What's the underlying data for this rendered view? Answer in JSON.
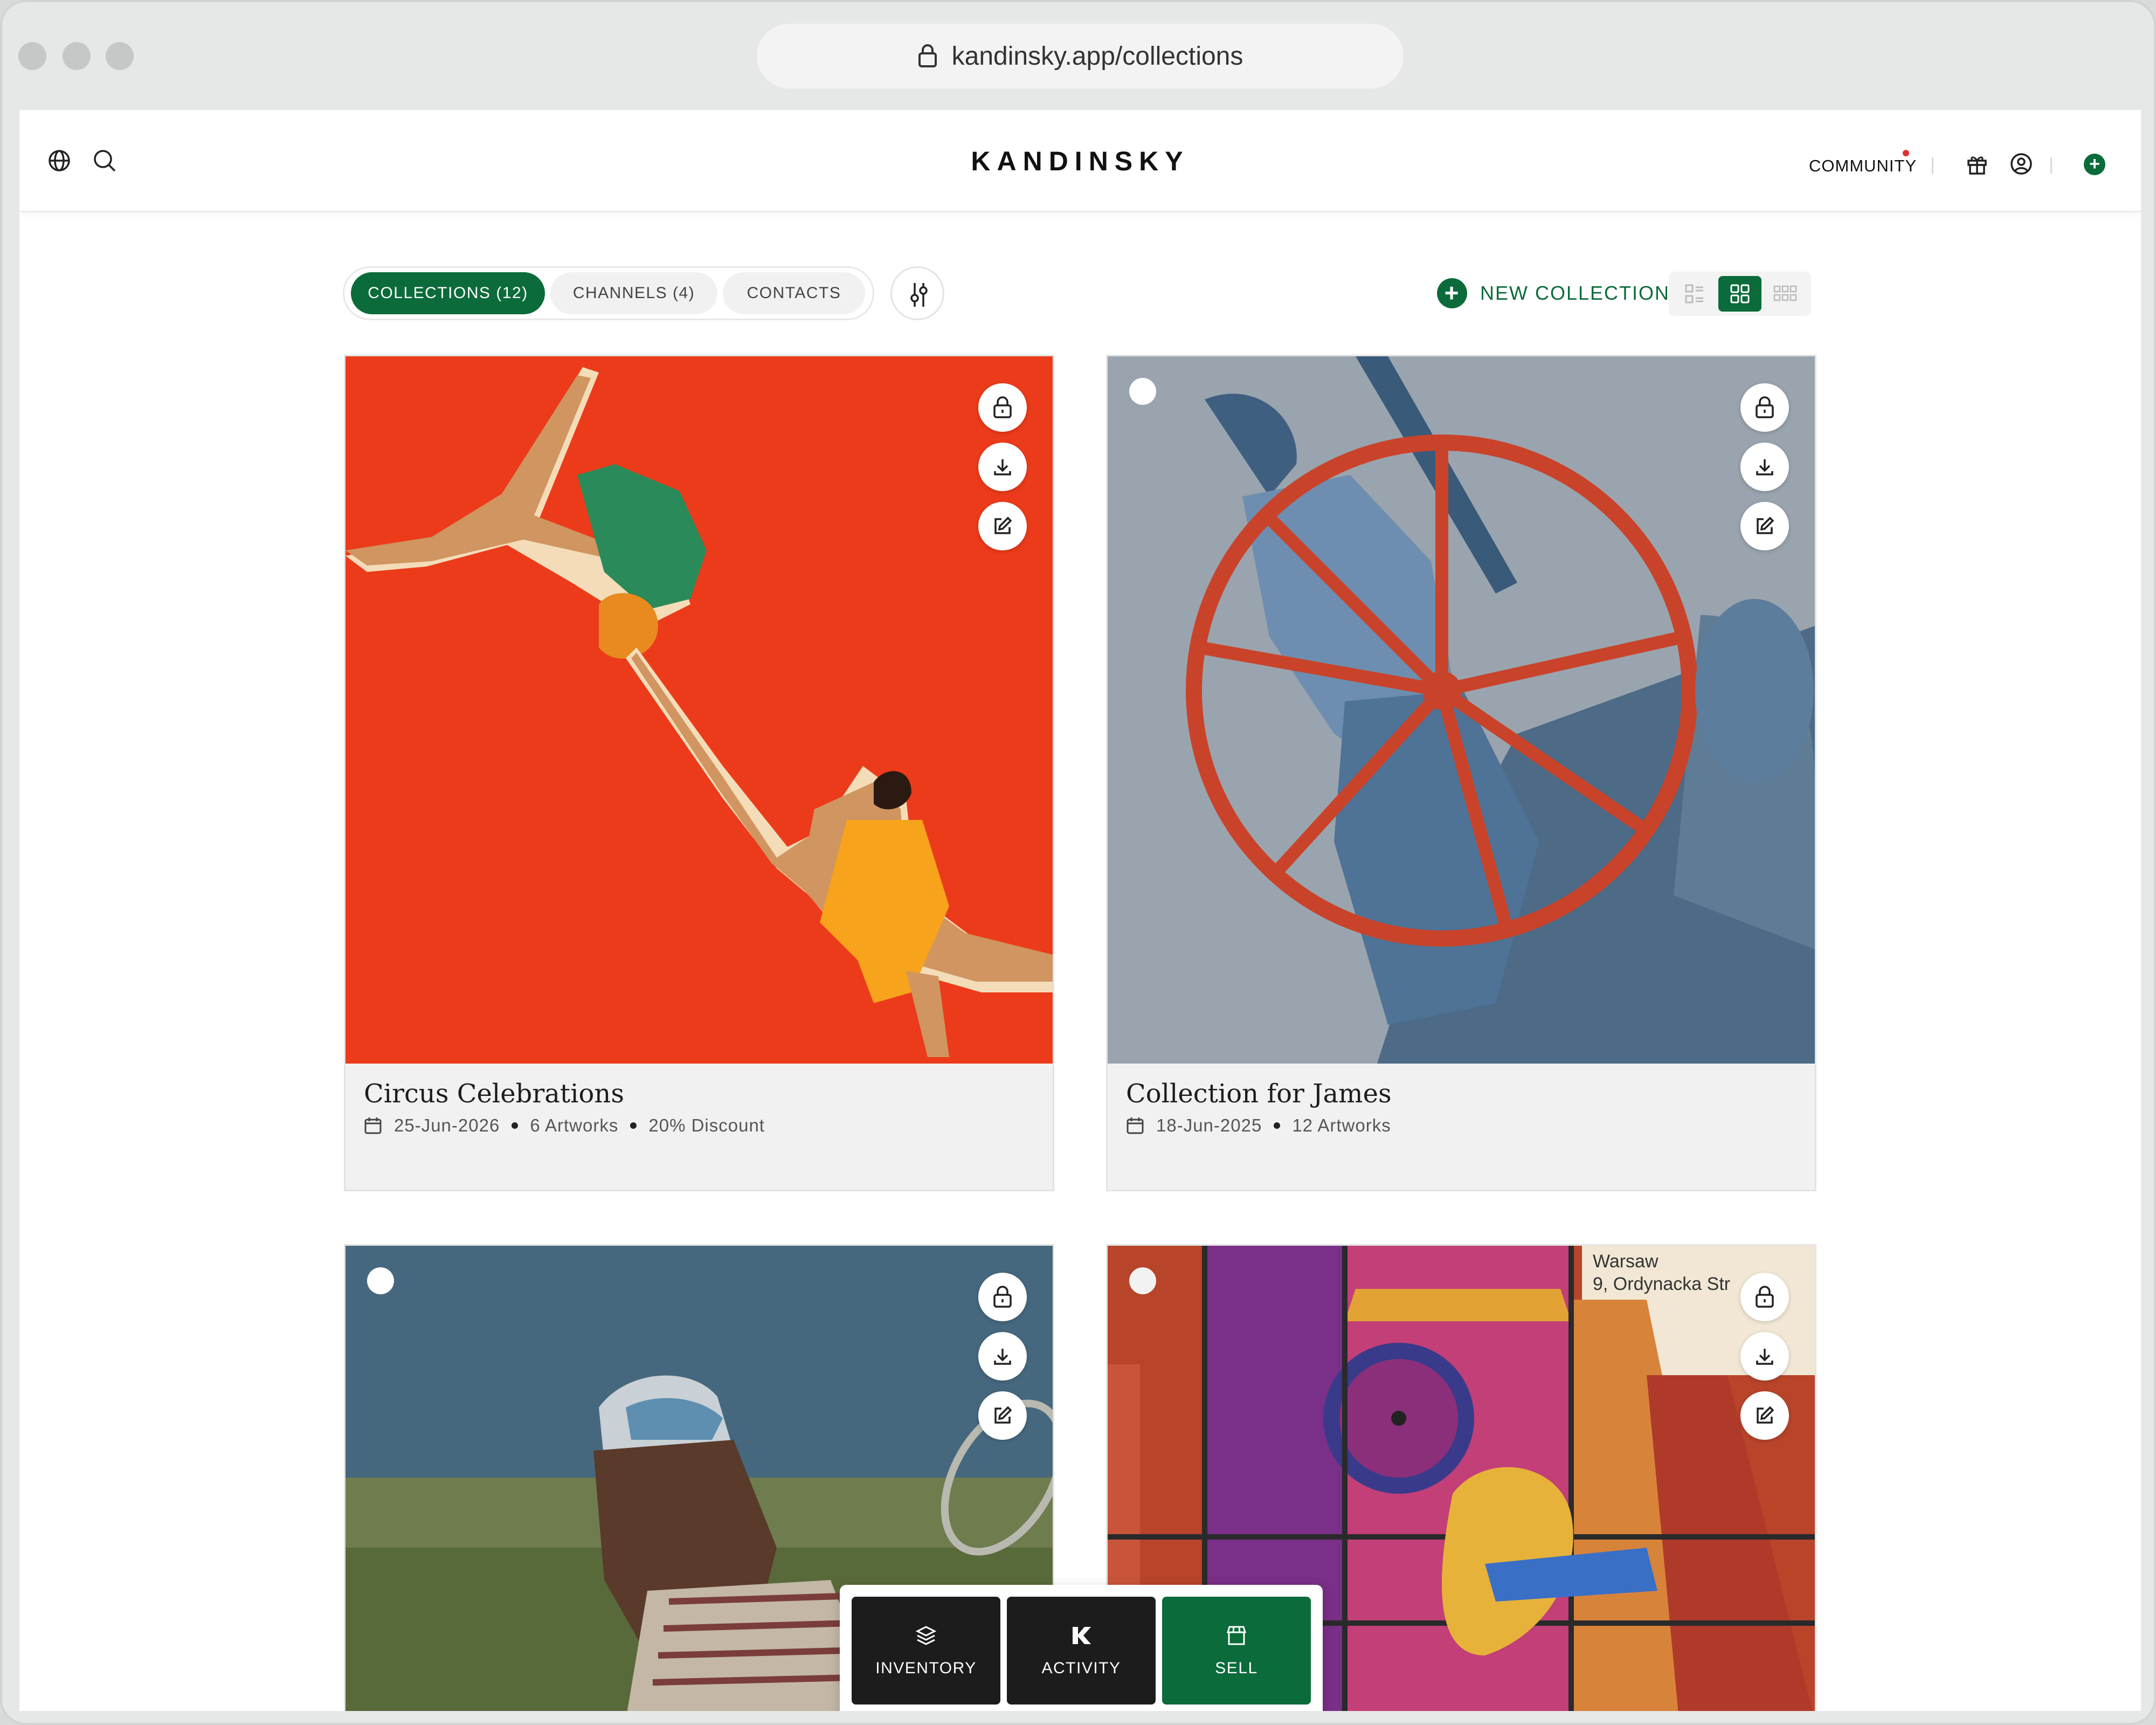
{
  "browser": {
    "url": "kandinsky.app/collections"
  },
  "header": {
    "logo": "KANDINSKY",
    "community_label": "COMMUNITY"
  },
  "tabs": [
    {
      "label": "COLLECTIONS  (12)",
      "active": true
    },
    {
      "label": "CHANNELS  (4)",
      "active": false
    },
    {
      "label": "CONTACTS",
      "active": false
    }
  ],
  "toolbar": {
    "new_collection_label": "NEW COLLECTION",
    "view_modes": [
      "list",
      "grid-medium",
      "grid-small"
    ],
    "active_view": "grid-medium"
  },
  "collections": [
    {
      "title": "Circus Celebrations",
      "date": "25-Jun-2026",
      "artworks": "6 Artworks",
      "discount": "20% Discount"
    },
    {
      "title": "Collection for James",
      "date": "18-Jun-2025",
      "artworks": "12 Artworks"
    },
    {
      "title": "",
      "date": "",
      "artworks": ""
    },
    {
      "title": "",
      "date": "",
      "artworks": "",
      "poster_text": "Warsaw\n9, Ordynacka Str"
    }
  ],
  "bottom_nav": [
    {
      "label": "INVENTORY",
      "icon": "layers-icon"
    },
    {
      "label": "ACTIVITY",
      "icon": "kandinsky-k-icon"
    },
    {
      "label": "SELL",
      "icon": "store-icon"
    }
  ],
  "colors": {
    "brand_green": "#0b6b3a",
    "notification_red": "#e03030"
  }
}
